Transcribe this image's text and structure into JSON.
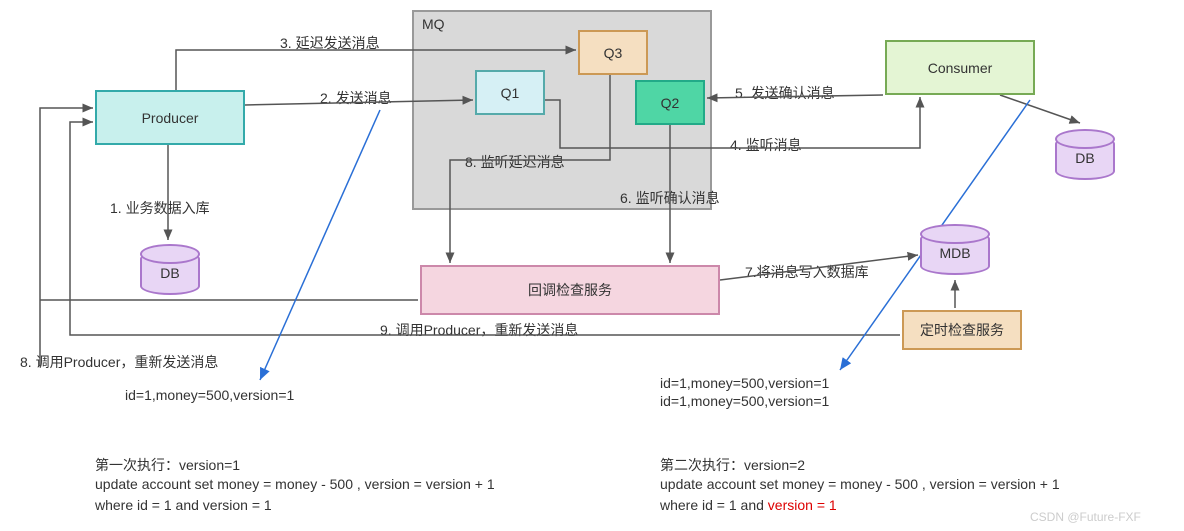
{
  "nodes": {
    "producer": "Producer",
    "consumer": "Consumer",
    "mq": "MQ",
    "q1": "Q1",
    "q2": "Q2",
    "q3": "Q3",
    "db1": "DB",
    "db2": "DB",
    "mdb": "MDB",
    "callback": "回调检查服务",
    "timer": "定时检查服务"
  },
  "edges": {
    "e1": "1. 业务数据入库",
    "e2": "2. 发送消息",
    "e3": "3. 延迟发送消息",
    "e4": "4. 监听消息",
    "e5": "5. 发送确认消息",
    "e6": "6. 监听确认消息",
    "e7": "7.将消息写入数据库",
    "e8": "8. 监听延迟消息",
    "e8b": "8. 调用Producer，重新发送消息",
    "e9": "9. 调用Producer，重新发送消息"
  },
  "annotations": {
    "left_id": "id=1,money=500,version=1",
    "right_id1": "id=1,money=500,version=1",
    "right_id2": "id=1,money=500,version=1",
    "exec1_title": "第一次执行：version=1",
    "exec1_sql1": "update account set money = money - 500 , version = version + 1",
    "exec1_sql2": "where id = 1 and version = 1",
    "exec2_title": "第二次执行：version=2",
    "exec2_sql1": "update account set money = money - 500 , version = version + 1",
    "exec2_sql2_pre": "where id = 1 and ",
    "exec2_sql2_red": "version = 1"
  },
  "watermark": "CSDN @Future-FXF"
}
